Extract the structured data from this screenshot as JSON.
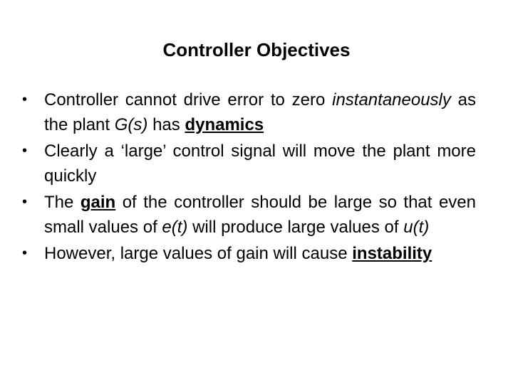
{
  "title": "Controller Objectives",
  "bullet_glyph": "•",
  "bullets": [
    {
      "segments": [
        {
          "text": "Controller cannot drive error to zero ",
          "style": "normal"
        },
        {
          "text": "instantaneously",
          "style": "italic"
        },
        {
          "text": " as the plant ",
          "style": "normal"
        },
        {
          "text": "G(s)",
          "style": "italic"
        },
        {
          "text": " has ",
          "style": "normal"
        },
        {
          "text": "dynamics",
          "style": "bold-underline"
        }
      ]
    },
    {
      "segments": [
        {
          "text": "Clearly a ‘large’ control signal will move the plant more quickly",
          "style": "normal"
        }
      ]
    },
    {
      "segments": [
        {
          "text": "The ",
          "style": "normal"
        },
        {
          "text": "gain",
          "style": "bold-underline"
        },
        {
          "text": " of the controller should be large so that even small values of ",
          "style": "normal"
        },
        {
          "text": "e(t)",
          "style": "italic"
        },
        {
          "text": " will produce large values of ",
          "style": "normal"
        },
        {
          "text": "u(t)",
          "style": "italic"
        }
      ]
    },
    {
      "segments": [
        {
          "text": "However, large values of gain will cause ",
          "style": "normal"
        },
        {
          "text": "instability",
          "style": "bold-underline"
        }
      ]
    }
  ]
}
